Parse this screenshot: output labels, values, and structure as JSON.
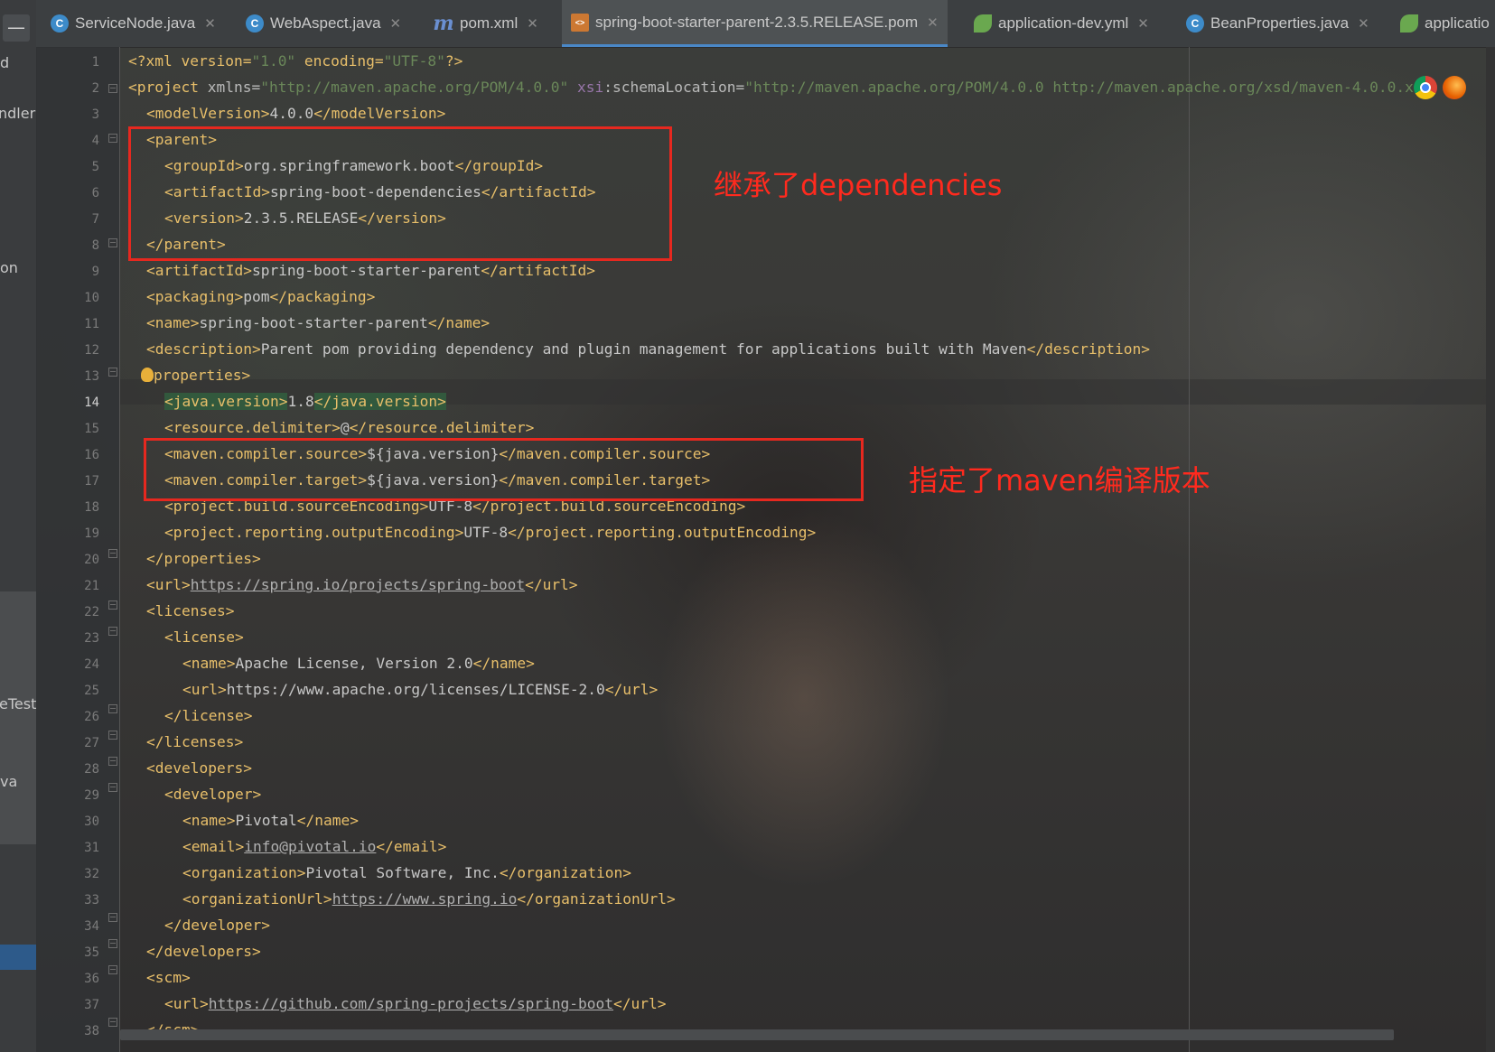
{
  "tabs": [
    {
      "label": "ServiceNode.java",
      "icon": "c"
    },
    {
      "label": "WebAspect.java",
      "icon": "c"
    },
    {
      "label": "pom.xml",
      "icon": "m"
    },
    {
      "label": "spring-boot-starter-parent-2.3.5.RELEASE.pom",
      "icon": "pom",
      "active": true
    },
    {
      "label": "application-dev.yml",
      "icon": "leaf"
    },
    {
      "label": "BeanProperties.java",
      "icon": "c"
    },
    {
      "label": "applicatio",
      "icon": "leaf"
    }
  ],
  "left_panel": {
    "fragments": [
      "d",
      "ndler",
      "on",
      "eTest",
      "va"
    ]
  },
  "line_numbers": [
    "1",
    "2",
    "3",
    "4",
    "5",
    "6",
    "7",
    "8",
    "9",
    "10",
    "11",
    "12",
    "13",
    "14",
    "15",
    "16",
    "17",
    "18",
    "19",
    "20",
    "21",
    "22",
    "23",
    "24",
    "25",
    "26",
    "27",
    "28",
    "29",
    "30",
    "31",
    "32",
    "33",
    "34",
    "35",
    "36",
    "37",
    "38"
  ],
  "current_line": "14",
  "code": {
    "l1": {
      "a": "<?xml version=",
      "b": "\"1.0\"",
      "c": " encoding=",
      "d": "\"UTF-8\"",
      "e": "?>"
    },
    "l2": {
      "a": "<project ",
      "b": "xmlns=",
      "c": "\"http://maven.apache.org/POM/4.0.0\"",
      "d": " xsi",
      ":": ":",
      "e": "schemaLocation=",
      "f": "\"http://maven.apache.org/POM/4.0.0 http://maven.apache.org/xsd/maven-4.0.0.x"
    },
    "l3": {
      "o": "<modelVersion>",
      "v": "4.0.0",
      "c": "</modelVersion>"
    },
    "l4": {
      "o": "<parent>"
    },
    "l5": {
      "o": "<groupId>",
      "v": "org.springframework.boot",
      "c": "</groupId>"
    },
    "l6": {
      "o": "<artifactId>",
      "v": "spring-boot-dependencies",
      "c": "</artifactId>"
    },
    "l7": {
      "o": "<version>",
      "v": "2.3.5.RELEASE",
      "c": "</version>"
    },
    "l8": {
      "o": "</parent>"
    },
    "l9": {
      "o": "<artifactId>",
      "v": "spring-boot-starter-parent",
      "c": "</artifactId>"
    },
    "l10": {
      "o": "<packaging>",
      "v": "pom",
      "c": "</packaging>"
    },
    "l11": {
      "o": "<name>",
      "v": "spring-boot-starter-parent",
      "c": "</name>"
    },
    "l12": {
      "o": "<description>",
      "v": "Parent pom providing dependency and plugin management for applications built with Maven",
      "c": "</description>"
    },
    "l13": {
      "o": "properties>"
    },
    "l14": {
      "o": "<java.version>",
      "v": "1.8",
      "c": "</java.version>"
    },
    "l15": {
      "o": "<resource.delimiter>",
      "v": "@",
      "c": "</resource.delimiter>"
    },
    "l16": {
      "o": "<maven.compiler.source>",
      "v": "${java.version}",
      "c": "</maven.compiler.source>"
    },
    "l17": {
      "o": "<maven.compiler.target>",
      "v": "${java.version}",
      "c": "</maven.compiler.target>"
    },
    "l18": {
      "o": "<project.build.sourceEncoding>",
      "v": "UTF-8",
      "c": "</project.build.sourceEncoding>"
    },
    "l19": {
      "o": "<project.reporting.outputEncoding>",
      "v": "UTF-8",
      "c": "</project.reporting.outputEncoding>"
    },
    "l20": {
      "o": "</properties>"
    },
    "l21": {
      "o": "<url>",
      "v": "https://spring.io/projects/spring-boot",
      "c": "</url>"
    },
    "l22": {
      "o": "<licenses>"
    },
    "l23": {
      "o": "<license>"
    },
    "l24": {
      "o": "<name>",
      "v": "Apache License, Version 2.0",
      "c": "</name>"
    },
    "l25": {
      "o": "<url>",
      "v": "https://www.apache.org/licenses/LICENSE-2.0",
      "c": "</url>"
    },
    "l26": {
      "o": "</license>"
    },
    "l27": {
      "o": "</licenses>"
    },
    "l28": {
      "o": "<developers>"
    },
    "l29": {
      "o": "<developer>"
    },
    "l30": {
      "o": "<name>",
      "v": "Pivotal",
      "c": "</name>"
    },
    "l31": {
      "o": "<email>",
      "v": "info@pivotal.io",
      "c": "</email>"
    },
    "l32": {
      "o": "<organization>",
      "v": "Pivotal Software, Inc.",
      "c": "</organization>"
    },
    "l33": {
      "o": "<organizationUrl>",
      "v": "https://www.spring.io",
      "c": "</organizationUrl>"
    },
    "l34": {
      "o": "</developer>"
    },
    "l35": {
      "o": "</developers>"
    },
    "l36": {
      "o": "<scm>"
    },
    "l37": {
      "o": "<url>",
      "v": "https://github.com/spring-projects/spring-boot",
      "c": "</url>"
    },
    "l38": {
      "o": "</scm>"
    }
  },
  "annotations": {
    "parent_note": "继承了dependencies",
    "compiler_note": "指定了maven编译版本"
  },
  "colors": {
    "tag": "#e8bf6a",
    "attr_value": "#6a8759",
    "annotation": "#ff2a1e",
    "active_tab_underline": "#4a88c7"
  }
}
